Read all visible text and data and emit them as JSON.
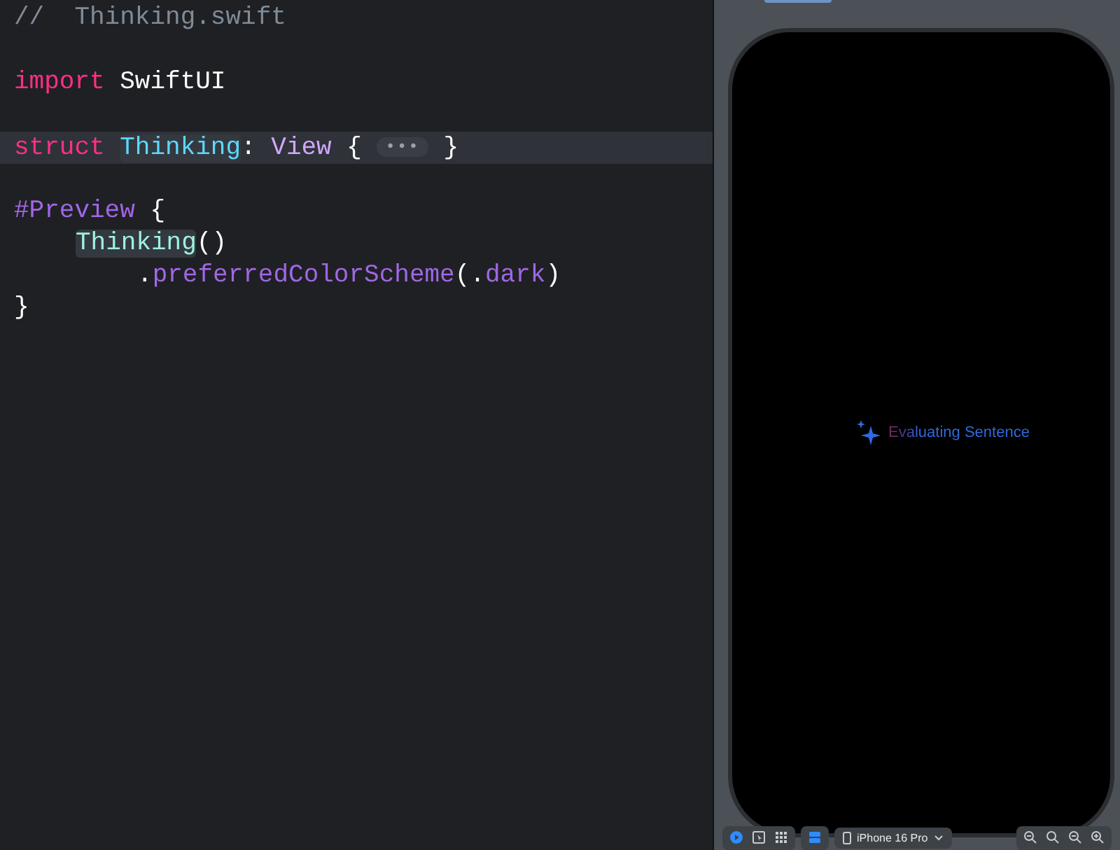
{
  "editor": {
    "lines": [
      {
        "kind": "code",
        "current": false,
        "tokens": [
          {
            "kind": "comment",
            "text": "//  Thinking.swift"
          }
        ]
      },
      {
        "kind": "blank"
      },
      {
        "kind": "code",
        "current": false,
        "tokens": [
          {
            "kind": "keyword",
            "text": "import"
          },
          {
            "kind": "plain",
            "text": " SwiftUI"
          }
        ]
      },
      {
        "kind": "blank"
      },
      {
        "kind": "code",
        "current": true,
        "tokens": [
          {
            "kind": "keyword",
            "text": "struct "
          },
          {
            "kind": "type-decl",
            "text": "Thinking"
          },
          {
            "kind": "plain",
            "text": ": "
          },
          {
            "kind": "type",
            "text": "View"
          },
          {
            "kind": "plain",
            "text": " { "
          },
          {
            "kind": "fold",
            "text": "•••"
          },
          {
            "kind": "plain",
            "text": " }"
          }
        ]
      },
      {
        "kind": "blank"
      },
      {
        "kind": "code",
        "current": false,
        "tokens": [
          {
            "kind": "macro",
            "text": "#Preview"
          },
          {
            "kind": "plain",
            "text": " {"
          }
        ],
        "children": [
          {
            "kind": "code",
            "current": false,
            "tokens": [
              {
                "kind": "type-ref",
                "text": "Thinking"
              },
              {
                "kind": "plain",
                "text": "()"
              }
            ],
            "children": [
              {
                "kind": "code",
                "current": false,
                "tokens": [
                  {
                    "kind": "plain",
                    "text": "."
                  },
                  {
                    "kind": "member",
                    "text": "preferredColorScheme"
                  },
                  {
                    "kind": "plain",
                    "text": "(."
                  },
                  {
                    "kind": "member",
                    "text": "dark"
                  },
                  {
                    "kind": "plain",
                    "text": ")"
                  }
                ]
              }
            ]
          }
        ]
      },
      {
        "kind": "code",
        "current": false,
        "tokens": [
          {
            "kind": "plain",
            "text": "}"
          }
        ]
      }
    ]
  },
  "preview": {
    "status": "Evaluating Sentence",
    "modes": [
      {
        "selected": true
      },
      {
        "selected": false
      },
      {
        "selected": false
      }
    ],
    "device": "iPhone 16 Pro"
  }
}
